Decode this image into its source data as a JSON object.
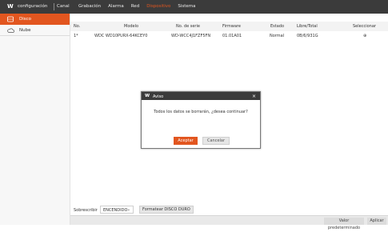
{
  "header": {
    "logo": "W",
    "title": "configuración",
    "channel": "Canal",
    "nav": [
      "Grabación",
      "Alarma",
      "Red",
      "Dispositivo",
      "Sistema"
    ],
    "active_nav": "Dispositivo",
    "accent": "#e2561f"
  },
  "sidebar": {
    "items": [
      {
        "label": "Disco",
        "icon": "hdd-icon",
        "active": true
      },
      {
        "label": "Nube",
        "icon": "cloud-icon",
        "active": false
      }
    ]
  },
  "table": {
    "headers": [
      "No.",
      "Modelo",
      "No. de serie",
      "Firmware",
      "Estado",
      "Libre/Total",
      "Seleccionar"
    ],
    "rows": [
      {
        "no": "1*",
        "model": "WDC WD10PURX-64KCEY0",
        "serial": "WD-WCC4J1FZF5FN",
        "firmware": "01.01A01",
        "status": "Normal",
        "free_total": "0B/6/931G",
        "select": "⊕"
      }
    ]
  },
  "dialog": {
    "logo": "W",
    "title": "Aviso",
    "close": "×",
    "message": "Todos los datos se borrarán, ¿desea continuar?",
    "ok": "Aceptar",
    "cancel": "Cancelar"
  },
  "controls": {
    "overwrite_label": "Sobrescribir",
    "overwrite_value": "ENCENDIDO",
    "format_button": "Formatear DISCO DURO"
  },
  "footer": {
    "defaults": "Valor predeterminado",
    "apply": "Aplicar"
  }
}
